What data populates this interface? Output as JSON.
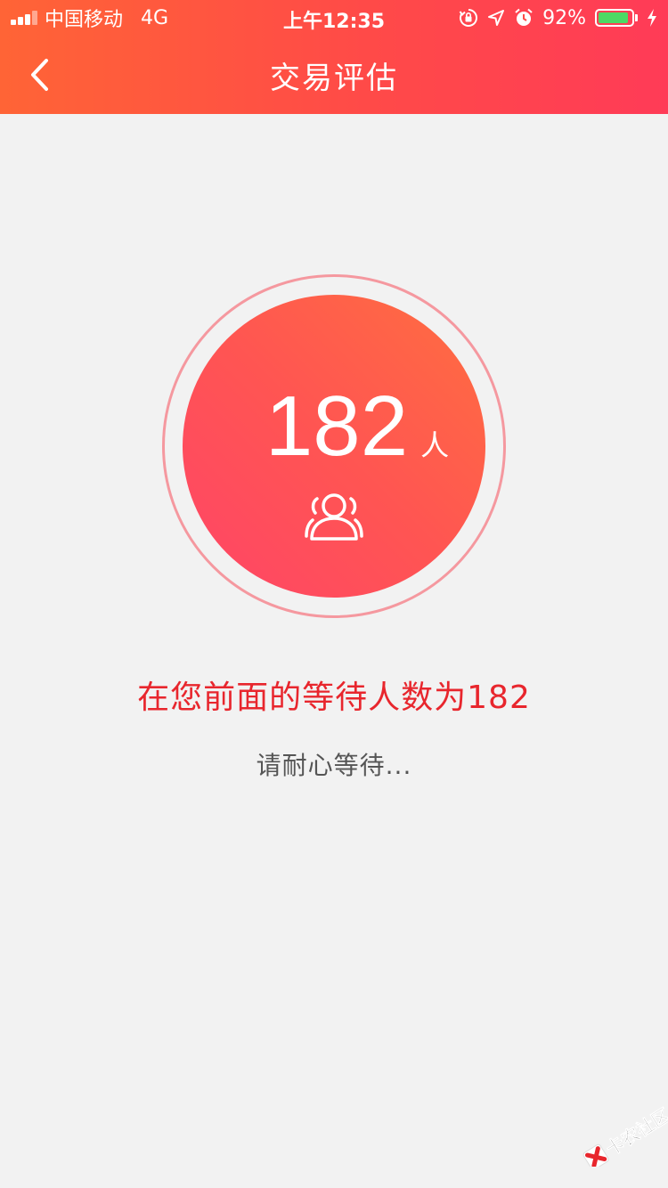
{
  "status_bar": {
    "carrier": "中国移动",
    "network": "4G",
    "time": "上午12:35",
    "battery_percent": "92%",
    "battery_level": 0.92,
    "icons": [
      "signal-icon",
      "orientation-lock-icon",
      "location-icon",
      "alarm-icon",
      "battery-icon",
      "charging-icon"
    ]
  },
  "nav": {
    "title": "交易评估",
    "back_icon": "chevron-left-icon"
  },
  "queue": {
    "count": "182",
    "unit": "人",
    "icon": "people-icon"
  },
  "message": {
    "main": "在您前面的等待人数为182",
    "sub": "请耐心等待..."
  },
  "watermark": {
    "text": "卡农社区"
  },
  "colors": {
    "header_start": "#ff6436",
    "header_end": "#ff3b57",
    "accent_red": "#e8262d",
    "ring": "#f5989f",
    "background": "#f2f2f2",
    "subtext": "#555555"
  }
}
